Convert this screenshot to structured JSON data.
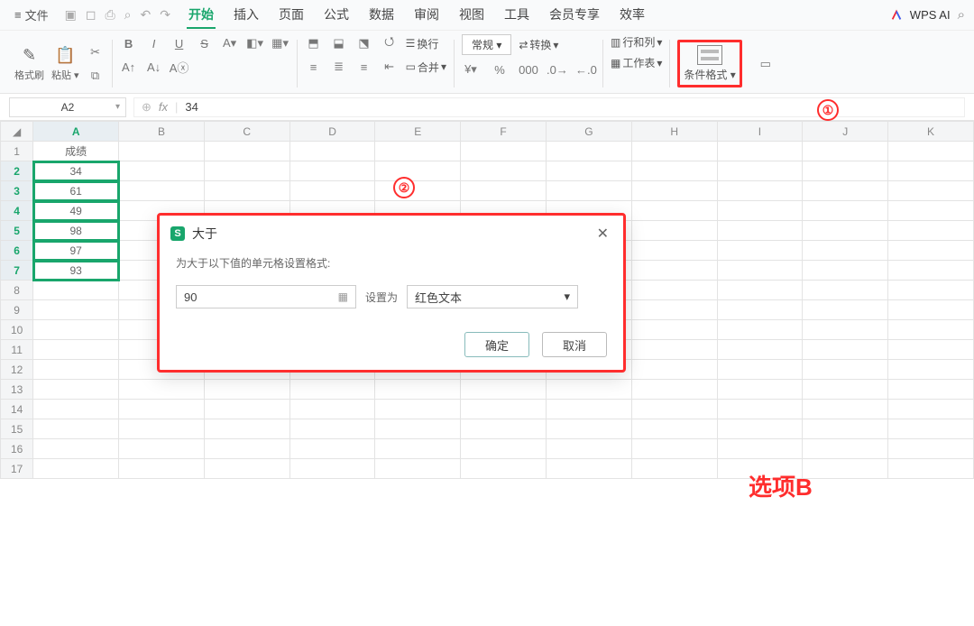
{
  "menubar": {
    "file_label": "文件",
    "tabs": [
      "开始",
      "插入",
      "页面",
      "公式",
      "数据",
      "审阅",
      "视图",
      "工具",
      "会员专享",
      "效率"
    ],
    "active_tab": "开始",
    "ai_label": "WPS AI"
  },
  "ribbon": {
    "format_painter": "格式刷",
    "paste": "粘贴",
    "number_format": "常规",
    "wrap": "转换",
    "rows_cols": "行和列",
    "sheet": "工作表",
    "cond_format": "条件格式",
    "merge": "合并",
    "linebreak": "换行"
  },
  "namebox": {
    "ref": "A2"
  },
  "formula": {
    "value": "34"
  },
  "columns": [
    "A",
    "B",
    "C",
    "D",
    "E",
    "F",
    "G",
    "H",
    "I",
    "J",
    "K"
  ],
  "data": {
    "header": "成绩",
    "values": [
      "34",
      "61",
      "49",
      "98",
      "97",
      "93"
    ]
  },
  "dialog": {
    "title": "大于",
    "desc": "为大于以下值的单元格设置格式:",
    "value": "90",
    "set_label": "设置为",
    "format_option": "红色文本",
    "ok": "确定",
    "cancel": "取消"
  },
  "annotations": {
    "circle1": "①",
    "circle2": "②",
    "label": "选项B"
  }
}
